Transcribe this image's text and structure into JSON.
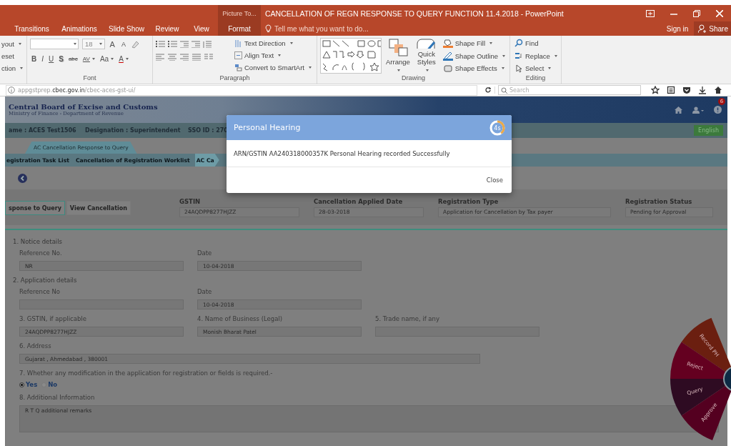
{
  "window": {
    "context_tab": "Picture To...",
    "title": "CANCELLATION OF REGN RESPONSE TO QUERY FUNCTION 11.4.2018 - PowerPoint"
  },
  "ribbon_tabs": [
    {
      "label": "Transitions",
      "selected": false
    },
    {
      "label": "Animations",
      "selected": false
    },
    {
      "label": "Slide Show",
      "selected": false
    },
    {
      "label": "Review",
      "selected": false
    },
    {
      "label": "View",
      "selected": false
    },
    {
      "label": "Format",
      "selected": true
    }
  ],
  "tell_me": {
    "placeholder": "Tell me what you want to do..."
  },
  "account": {
    "sign_in": "Sign in",
    "share": "Share"
  },
  "ribbon": {
    "slides": {
      "commands": [
        {
          "label": "yout",
          "dropdown": true
        },
        {
          "label": "eset",
          "dropdown": false
        },
        {
          "label": "ction",
          "dropdown": true
        }
      ]
    },
    "font": {
      "label": "Font",
      "size": "18",
      "grow": [
        {
          "label": "A"
        },
        {
          "label": "A"
        }
      ],
      "styles": [
        {
          "kind": "bold",
          "label": "B",
          "dropdown": false
        },
        {
          "kind": "italic",
          "label": "I",
          "dropdown": false
        },
        {
          "kind": "underline",
          "label": "U",
          "dropdown": false
        },
        {
          "kind": "shadow",
          "label": "S",
          "dropdown": false
        },
        {
          "kind": "strike",
          "label": "abc",
          "dropdown": false
        },
        {
          "kind": "spacing",
          "label": "AV",
          "dropdown": true
        },
        {
          "kind": "case",
          "label": "Aa",
          "dropdown": true
        },
        {
          "kind": "color",
          "label": "A",
          "dropdown": true
        }
      ]
    },
    "paragraph": {
      "label": "Paragraph",
      "commands": [
        {
          "label": "Text Direction",
          "dropdown": true
        },
        {
          "label": "Align Text",
          "dropdown": true
        },
        {
          "label": "Convert to SmartArt",
          "dropdown": true
        }
      ]
    },
    "drawing": {
      "label": "Drawing",
      "large": [
        {
          "label": "Arrange",
          "dropdown": true
        },
        {
          "label": "Quick Styles",
          "dropdown": true
        }
      ],
      "commands": [
        {
          "label": "Shape Fill",
          "dropdown": true
        },
        {
          "label": "Shape Outline",
          "dropdown": true
        },
        {
          "label": "Shape Effects",
          "dropdown": true
        }
      ]
    },
    "editing": {
      "label": "Editing",
      "commands": [
        {
          "label": "Find",
          "dropdown": false
        },
        {
          "label": "Replace",
          "dropdown": true
        },
        {
          "label": "Select",
          "dropdown": true
        }
      ]
    }
  },
  "browser": {
    "url": "appgstprep.**cbec.gov.in**/cbec-aces-gst-ui/",
    "search_placeholder": "Search"
  },
  "page": {
    "org": "Central Board of Excise and Customs",
    "ministry": "Ministry of Finance - Department of Revenue",
    "notification_count": "6",
    "user_bar": [
      "ame : ACES Test1506",
      "Designation : Superintendent",
      "SSO ID : 270"
    ],
    "language": "English",
    "tab": "AC Cancellation Response to Query",
    "breadcrumb": [
      {
        "label": "egistration Task List",
        "selected": false
      },
      {
        "label": "Cancellation of Registration Worklist",
        "selected": false
      },
      {
        "label": "AC Ca",
        "selected": true
      }
    ],
    "actions": [
      {
        "label": "sponse to Query",
        "selected": true
      },
      {
        "label": "View Cancellation",
        "selected": false
      }
    ],
    "summary": [
      {
        "label": "GSTIN",
        "value": "24AQDPP8277HJZZ"
      },
      {
        "label": "Cancellation Applied Date",
        "value": "28-03-2018"
      },
      {
        "label": "Registration Type",
        "value": "Application for Cancellation by Tax payer"
      },
      {
        "label": "Registration Status",
        "value": "Pending for Approval"
      }
    ],
    "form": [
      {
        "kind": "heading",
        "text": "1. Notice details"
      },
      {
        "kind": "fields",
        "fields": [
          {
            "label": "Reference No.",
            "value": "NR"
          },
          {
            "label": "Date",
            "value": "10-04-2018"
          }
        ]
      },
      {
        "kind": "heading",
        "text": "2. Application details"
      },
      {
        "kind": "fields",
        "fields": [
          {
            "label": "Reference No"
          },
          {
            "label": "Date",
            "value": "10-04-2018"
          }
        ]
      },
      {
        "kind": "fields",
        "fields": [
          {
            "label": "3. GSTIN, if applicable",
            "value": "24AQDPP8277HJZZ"
          },
          {
            "label": "4. Name of Business (Legal)",
            "value": "Monish Bharat Patel"
          },
          {
            "label": "5. Trade name, if any"
          }
        ]
      },
      {
        "kind": "wide",
        "label": "6. Address",
        "value": "Gujarat , Ahmedabad , 380001"
      },
      {
        "kind": "radio",
        "label": "7. Whether any modification in the application for registration or fields is required.-",
        "options": [
          {
            "label": "Yes",
            "selected": true
          },
          {
            "label": "No",
            "selected": false
          }
        ]
      },
      {
        "kind": "textarea",
        "label": "8. Additional Information",
        "value": "R T Q additional remarks"
      }
    ]
  },
  "modal": {
    "title": "Personal Hearing",
    "timer": {
      "text": "4s",
      "level": 0.4
    },
    "message": "ARN/GSTIN AA240318000357K Personal Hearing recorded Successfully",
    "close": "Close"
  },
  "radial_menu": [
    {
      "label": "Record PH",
      "color": "#6b1f10"
    },
    {
      "label": "Reject",
      "color": "#640020"
    },
    {
      "label": "Query",
      "color": "#2e0b22"
    },
    {
      "label": "Approve",
      "color": "#540020"
    }
  ]
}
